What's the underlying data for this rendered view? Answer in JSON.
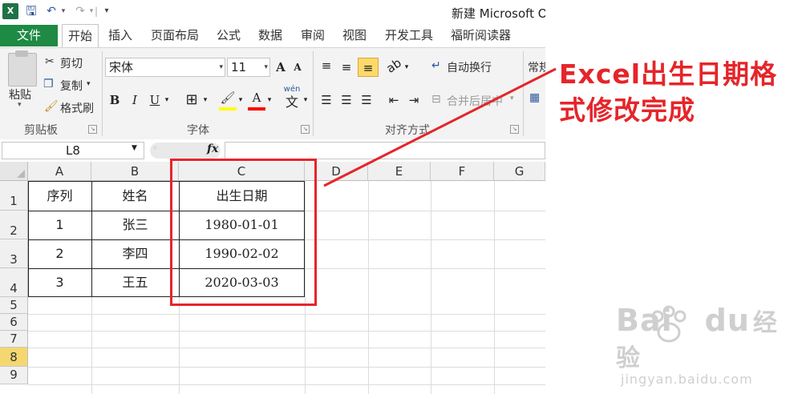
{
  "window": {
    "title": "新建 Microsoft O"
  },
  "qat": {
    "app_icon": "X",
    "save_icon": "save-icon",
    "undo_icon": "undo-icon",
    "redo_icon": "redo-icon"
  },
  "tabs": {
    "file": "文件",
    "items": [
      "开始",
      "插入",
      "页面布局",
      "公式",
      "数据",
      "审阅",
      "视图",
      "开发工具",
      "福昕阅读器"
    ],
    "active": "开始"
  },
  "ribbon": {
    "clipboard": {
      "paste": "粘贴",
      "cut": "剪切",
      "copy": "复制",
      "format_painter": "格式刷",
      "group": "剪贴板"
    },
    "font": {
      "name": "宋体",
      "size": "11",
      "grow": "A",
      "shrink": "A",
      "bold": "B",
      "italic": "I",
      "underline": "U",
      "font_color_letter": "A",
      "phonetic": "wén",
      "phonetic_char": "文",
      "group": "字体",
      "fill_color": "#ffff00",
      "font_color": "#ff0000"
    },
    "alignment": {
      "wrap": "自动换行",
      "merge": "合并后居中",
      "group": "对齐方式"
    },
    "number": {
      "format": "常规"
    }
  },
  "formula_bar": {
    "name_box": "L8",
    "fx": "fx",
    "formula": ""
  },
  "grid": {
    "columns": [
      "A",
      "B",
      "C",
      "D",
      "E",
      "F",
      "G"
    ],
    "rows": [
      "1",
      "2",
      "3",
      "4",
      "5",
      "6",
      "7",
      "8",
      "9"
    ],
    "selected_row": "8",
    "table": {
      "headers": [
        "序列",
        "姓名",
        "出生日期"
      ],
      "rows": [
        [
          "1",
          "张三",
          "1980-01-01"
        ],
        [
          "2",
          "李四",
          "1990-02-02"
        ],
        [
          "3",
          "王五",
          "2020-03-03"
        ]
      ]
    }
  },
  "annotation": {
    "line1": "Excel出生日期格",
    "line2": "式修改完成",
    "color": "#e5252a"
  },
  "watermark": {
    "main_left": "Bai",
    "main_right": "du",
    "cn": "经验",
    "url": "jingyan.baidu.com"
  }
}
